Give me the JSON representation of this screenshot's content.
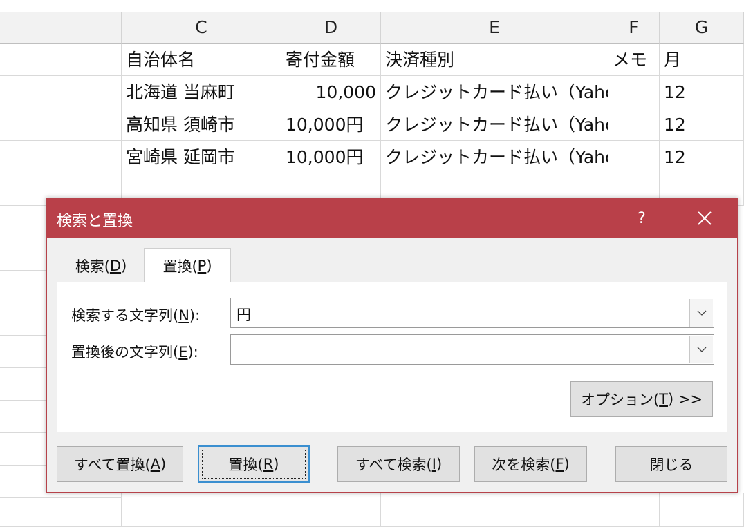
{
  "sheet": {
    "columns": [
      "C",
      "D",
      "E",
      "F",
      "G"
    ],
    "rows": [
      [
        "自治体名",
        "寄付金額",
        "決済種別",
        "メモ",
        "月"
      ],
      [
        "北海道 当麻町",
        "10,000",
        "クレジットカード払い（Yahoo",
        "",
        "12"
      ],
      [
        "高知県 須崎市",
        "10,000円",
        "クレジットカード払い（Yahoo",
        "",
        "12"
      ],
      [
        "宮崎県 延岡市",
        "10,000円",
        "クレジットカード払い（Yahoo",
        "",
        "12"
      ]
    ]
  },
  "dialog": {
    "title": "検索と置換",
    "help": "?",
    "tabs": [
      {
        "label": "検索(",
        "key": "D",
        "suffix": ")"
      },
      {
        "label": "置換(",
        "key": "P",
        "suffix": ")"
      }
    ],
    "find": {
      "label": "検索する文字列(",
      "key": "N",
      "suffix": "):",
      "value": "円"
    },
    "replace": {
      "label": "置換後の文字列(",
      "key": "E",
      "suffix": "):",
      "value": ""
    },
    "options_button": {
      "label": "オプション(",
      "key": "T",
      "suffix": ") >>"
    },
    "buttons": {
      "replace_all": {
        "label": "すべて置換(",
        "key": "A",
        "suffix": ")"
      },
      "replace": {
        "label": "置換(",
        "key": "R",
        "suffix": ")"
      },
      "find_all": {
        "label": "すべて検索(",
        "key": "I",
        "suffix": ")"
      },
      "find_next": {
        "label": "次を検索(",
        "key": "F",
        "suffix": ")"
      },
      "close": {
        "label": "閉じる"
      }
    },
    "colors": {
      "titlebar": "#b94049",
      "default_button_border": "#3b8fd0"
    }
  }
}
